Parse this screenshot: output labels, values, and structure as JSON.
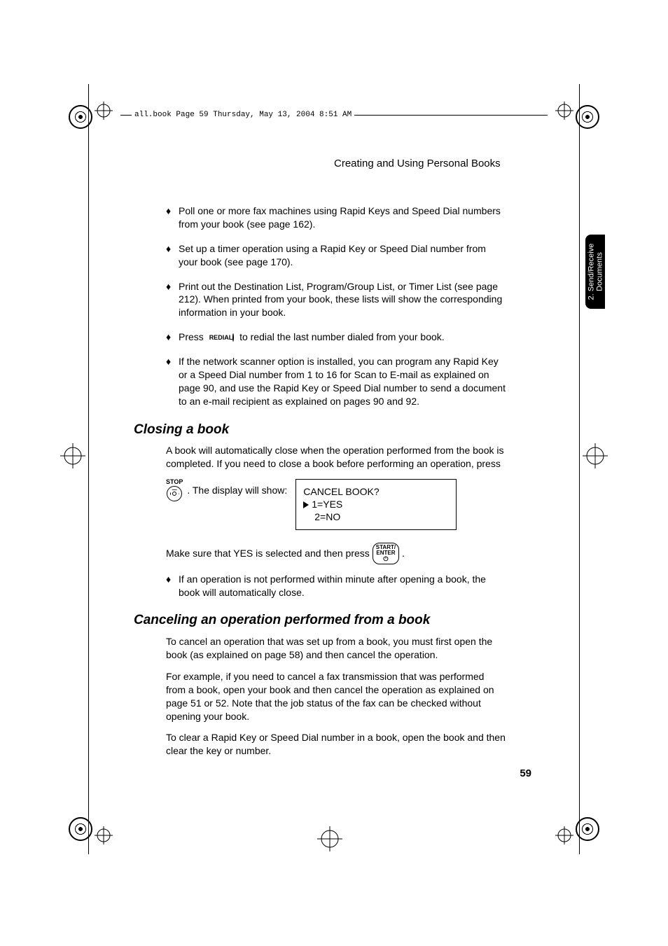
{
  "header": {
    "crop_line": "all.book  Page 59  Thursday, May 13, 2004  8:51 AM",
    "section_title": "Creating and Using Personal Books"
  },
  "side_tab": {
    "line1": "2. Send/Receive",
    "line2": "Documents"
  },
  "bullets_top": [
    "Poll one or more fax machines using Rapid Keys and Speed Dial numbers from your book (see page 162).",
    "Set up a timer operation using a Rapid Key or Speed Dial number from your book (see page 170).",
    "Print out the Destination List, Program/Group List, or Timer List (see page 212). When printed from your book, these lists will show the corresponding information in your book."
  ],
  "bullet_press": {
    "pre": "Press ",
    "redial_label": "REDIAL",
    "post": " to redial the last number dialed from your book."
  },
  "bullet_network": "If the network scanner option is installed, you can program any Rapid Key or a Speed Dial number from 1 to 16 for Scan to E-mail as explained on page 90, and use the Rapid Key or Speed Dial number to send a document to an e-mail recipient as explained on pages 90 and 92.",
  "closing": {
    "heading": "Closing a book",
    "intro": "A book will automatically close when the operation performed from the book is completed. If you need to close a book before performing an operation, press",
    "stop_label": "STOP",
    "after_stop": ". The display will show:",
    "lcd": {
      "l1": "CANCEL BOOK?",
      "l2": "1=YES",
      "l3": "2=NO"
    },
    "make_sure_pre": "Make sure that YES is selected and then press ",
    "start_l1": "START/",
    "start_l2": "ENTER",
    "make_sure_post": ".",
    "note": "If an operation is not performed within minute after opening a book, the book will automatically close."
  },
  "cancel": {
    "heading": "Canceling an operation performed from a book",
    "p1": "To cancel an operation that was set up from a book, you must first open the book (as explained on page 58) and then cancel the operation.",
    "p2": "For example, if you need to cancel a fax transmission that was performed from a book, open your book and then cancel the operation as explained on page 51 or 52. Note that the job status of the fax can be checked without opening your book.",
    "p3": "To clear a Rapid Key or Speed Dial number in a book, open the book and then clear the key or number."
  },
  "page_number": "59"
}
